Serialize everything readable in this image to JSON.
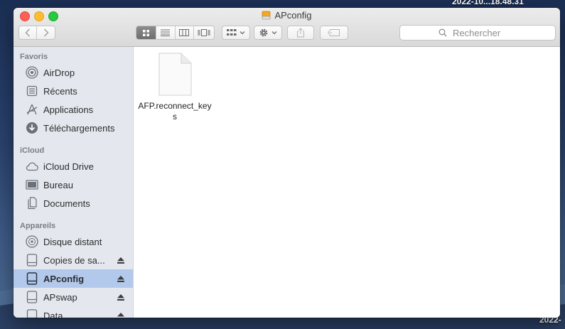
{
  "desktop": {
    "top_label": "2022-10...18.48.31",
    "bottom_label": "2022-"
  },
  "window": {
    "title": "APconfig"
  },
  "toolbar": {
    "back_icon": "chevron-left-icon",
    "forward_icon": "chevron-right-icon",
    "views": [
      "icon-view-icon",
      "list-view-icon",
      "column-view-icon",
      "gallery-view-icon"
    ],
    "active_view": "icon-view-icon",
    "search_placeholder": "Rechercher"
  },
  "sidebar": {
    "sections": [
      {
        "title": "Favoris",
        "items": [
          {
            "label": "AirDrop",
            "icon": "airdrop-icon"
          },
          {
            "label": "Récents",
            "icon": "recents-icon"
          },
          {
            "label": "Applications",
            "icon": "applications-icon"
          },
          {
            "label": "Téléchargements",
            "icon": "downloads-icon"
          }
        ]
      },
      {
        "title": "iCloud",
        "items": [
          {
            "label": "iCloud Drive",
            "icon": "cloud-icon"
          },
          {
            "label": "Bureau",
            "icon": "desktop-icon"
          },
          {
            "label": "Documents",
            "icon": "documents-icon"
          }
        ]
      },
      {
        "title": "Appareils",
        "items": [
          {
            "label": "Disque distant",
            "icon": "disc-icon"
          },
          {
            "label": "Copies de sa...",
            "icon": "drive-icon",
            "eject": true
          },
          {
            "label": "APconfig",
            "icon": "drive-icon",
            "eject": true,
            "selected": true
          },
          {
            "label": "APswap",
            "icon": "drive-icon",
            "eject": true
          },
          {
            "label": "Data",
            "icon": "drive-icon",
            "eject": true
          }
        ]
      }
    ]
  },
  "content": {
    "files": [
      {
        "name": "AFP.reconnect_keys",
        "icon": "document-icon"
      }
    ]
  },
  "colors": {
    "selection": "#b3c9ec",
    "sidebar_bg": "#e4e8ee",
    "close": "#fe5f57",
    "minimize": "#febc2e",
    "maximize": "#28c840"
  }
}
